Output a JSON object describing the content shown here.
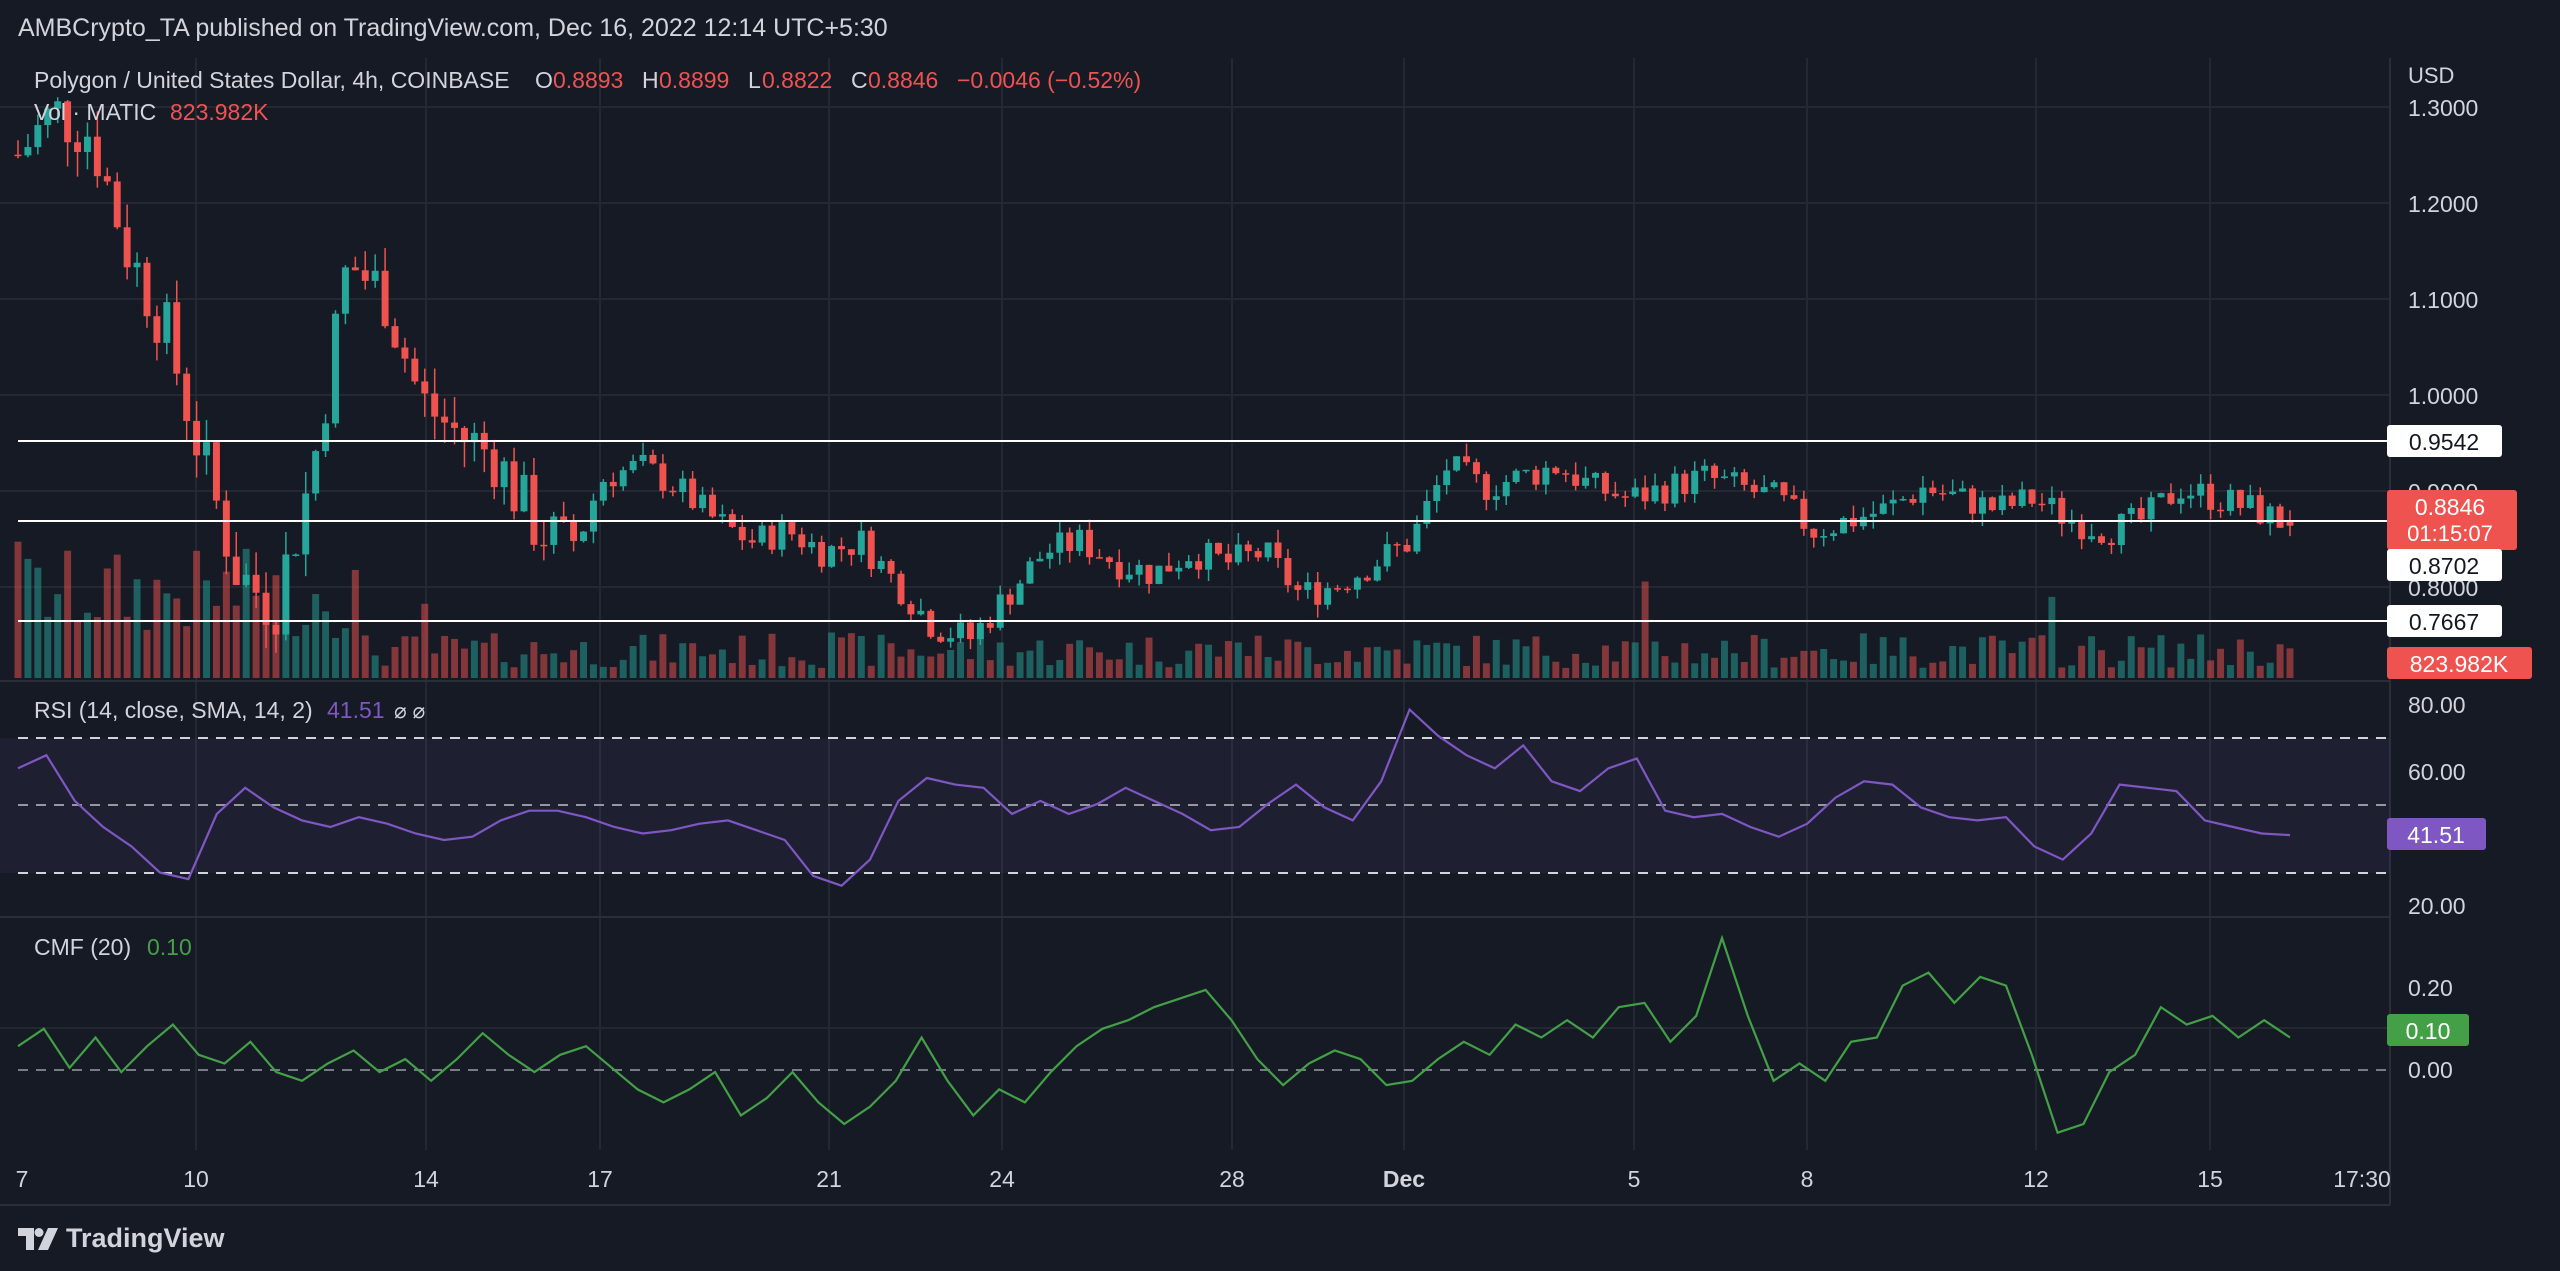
{
  "header": {
    "published": "AMBCrypto_TA published on TradingView.com, Dec 16, 2022 12:14 UTC+5:30"
  },
  "footer": {
    "brand": "TradingView"
  },
  "legend": {
    "symbol": "Polygon / United States Dollar, 4h, COINBASE",
    "o_label": "O",
    "o_value": "0.8893",
    "h_label": "H",
    "h_value": "0.8899",
    "l_label": "L",
    "l_value": "0.8822",
    "c_label": "C",
    "c_value": "0.8846",
    "change": "−0.0046 (−0.52%)",
    "vol_label": "Vol · MATIC",
    "vol_value": "823.982K",
    "rsi_label": "RSI (14, close, SMA, 14, 2)",
    "rsi_value": "41.51",
    "rsi_icons": "⌀ ⌀",
    "cmf_label": "CMF (20)",
    "cmf_value": "0.10"
  },
  "price_axis": {
    "currency": "USD",
    "ticks": [
      "1.3000",
      "1.2000",
      "1.1000",
      "1.0000",
      "0.9000",
      "0.8000"
    ]
  },
  "rsi_axis": {
    "ticks": [
      "80.00",
      "60.00",
      "20.00"
    ]
  },
  "cmf_axis": {
    "ticks": [
      "0.20",
      "0.00"
    ]
  },
  "badges": {
    "level_high": "0.9542",
    "price": "0.8846",
    "countdown": "01:15:07",
    "level_mid": "0.8702",
    "level_low": "0.7667",
    "volume": "823.982K",
    "rsi": "41.51",
    "cmf": "0.10"
  },
  "time_axis": {
    "labels": [
      "7",
      "10",
      "14",
      "17",
      "21",
      "24",
      "28",
      "Dec",
      "5",
      "8",
      "12",
      "15",
      "17:30"
    ]
  },
  "colors": {
    "up": "#26a69a",
    "down": "#ef5350",
    "rsi": "#7e57c2",
    "cmf": "#43a047",
    "bg": "#161a25",
    "grid": "#242833",
    "text": "#d1d4dc",
    "level": "#ffffff"
  },
  "chart_data": [
    {
      "type": "candlestick",
      "title": "Polygon / United States Dollar, 4h, COINBASE",
      "ylim": [
        0.74,
        1.32
      ],
      "yticks": [
        1.3,
        1.2,
        1.1,
        1.0,
        0.9,
        0.8
      ],
      "x_labels": [
        "7",
        "10",
        "14",
        "17",
        "21",
        "24",
        "28",
        "Dec",
        "5",
        "8",
        "12",
        "15",
        "17:30"
      ],
      "horizontal_levels": [
        0.9542,
        0.8702,
        0.7667
      ],
      "last": {
        "open": 0.8893,
        "high": 0.8899,
        "low": 0.8822,
        "close": 0.8846
      },
      "close_path": [
        1.23,
        1.27,
        1.25,
        1.14,
        1.07,
        0.95,
        0.84,
        0.81,
        0.93,
        1.13,
        1.1,
        1.0,
        0.97,
        0.95,
        0.89,
        0.86,
        0.93,
        0.94,
        0.92,
        0.89,
        0.87,
        0.88,
        0.86,
        0.87,
        0.83,
        0.79,
        0.78,
        0.82,
        0.86,
        0.87,
        0.85,
        0.84,
        0.86,
        0.85,
        0.86,
        0.82,
        0.83,
        0.85,
        0.87,
        0.94,
        0.92,
        0.93,
        0.94,
        0.92,
        0.91,
        0.92,
        0.93,
        0.92,
        0.91,
        0.88,
        0.89,
        0.9,
        0.92,
        0.91,
        0.9,
        0.91,
        0.89,
        0.88,
        0.89,
        0.92,
        0.91,
        0.9,
        0.8846
      ]
    },
    {
      "type": "bar",
      "title": "Vol · MATIC",
      "last_value": "823.982K"
    },
    {
      "type": "line",
      "title": "RSI (14, close, SMA, 14, 2)",
      "ylim": [
        17,
        86
      ],
      "yticks": [
        80,
        60,
        20
      ],
      "bands": [
        70,
        50,
        30
      ],
      "last_value": 41.51,
      "values": [
        62,
        66,
        52,
        44,
        38,
        30,
        28,
        48,
        56,
        50,
        46,
        44,
        47,
        45,
        42,
        40,
        41,
        46,
        49,
        49,
        47,
        44,
        42,
        43,
        45,
        46,
        43,
        40,
        29,
        26,
        34,
        52,
        59,
        57,
        56,
        48,
        52,
        48,
        51,
        56,
        52,
        48,
        43,
        44,
        51,
        57,
        50,
        46,
        58,
        80,
        72,
        66,
        62,
        69,
        58,
        55,
        62,
        65,
        49,
        47,
        48,
        44,
        41,
        45,
        53,
        58,
        57,
        50,
        47,
        46,
        47,
        38,
        34,
        42,
        57,
        56,
        55,
        46,
        44,
        42,
        41.51
      ]
    },
    {
      "type": "line",
      "title": "CMF (20)",
      "ylim": [
        -0.16,
        0.36
      ],
      "yticks": [
        0.2,
        0.0
      ],
      "zero_line": 0.0,
      "last_value": 0.1,
      "values": [
        0.08,
        0.12,
        0.03,
        0.1,
        0.02,
        0.08,
        0.13,
        0.06,
        0.04,
        0.09,
        0.02,
        0.0,
        0.04,
        0.07,
        0.02,
        0.05,
        0.0,
        0.05,
        0.11,
        0.06,
        0.02,
        0.06,
        0.08,
        0.03,
        -0.02,
        -0.05,
        -0.02,
        0.02,
        -0.08,
        -0.04,
        0.02,
        -0.05,
        -0.1,
        -0.06,
        0.0,
        0.1,
        0.0,
        -0.08,
        -0.02,
        -0.05,
        0.02,
        0.08,
        0.12,
        0.14,
        0.17,
        0.19,
        0.21,
        0.14,
        0.05,
        -0.01,
        0.04,
        0.07,
        0.05,
        -0.01,
        0.0,
        0.05,
        0.09,
        0.06,
        0.13,
        0.1,
        0.14,
        0.1,
        0.17,
        0.18,
        0.09,
        0.15,
        0.33,
        0.15,
        0.0,
        0.04,
        0.0,
        0.09,
        0.1,
        0.22,
        0.25,
        0.18,
        0.24,
        0.22,
        0.06,
        -0.12,
        -0.1,
        0.02,
        0.06,
        0.17,
        0.13,
        0.15,
        0.1,
        0.14,
        0.1
      ]
    }
  ]
}
